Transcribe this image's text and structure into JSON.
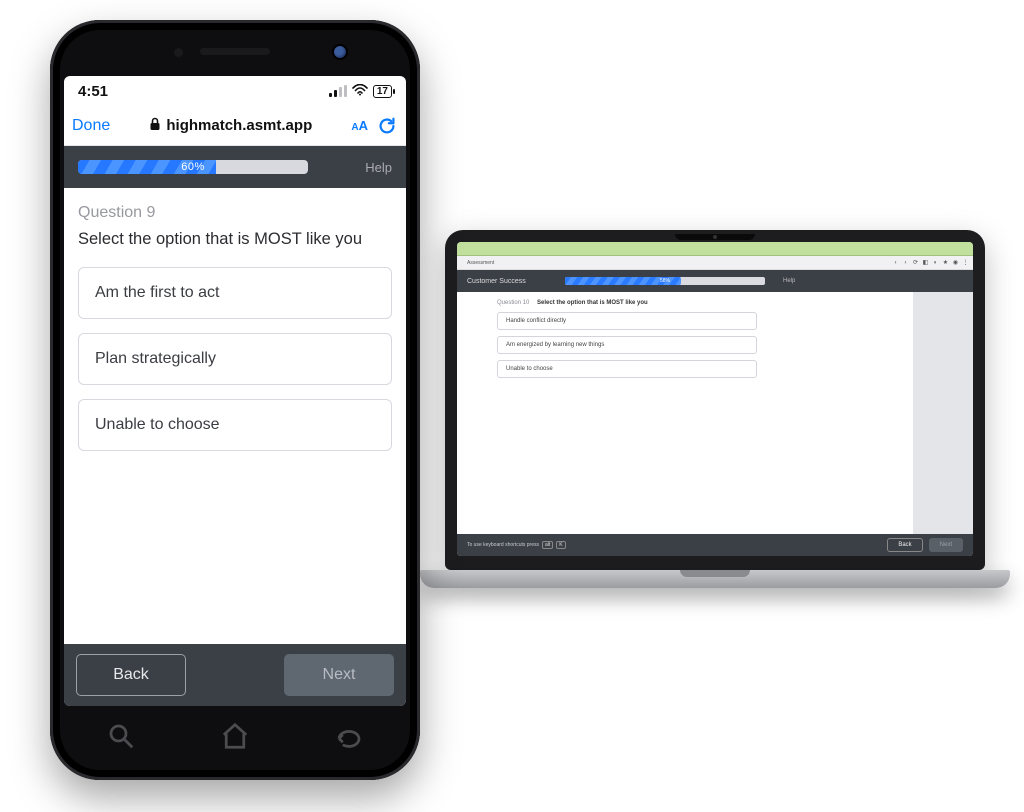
{
  "phone": {
    "status": {
      "time": "4:51",
      "battery": "17"
    },
    "safari": {
      "done": "Done",
      "url": "highmatch.asmt.app",
      "aa": "AA"
    },
    "progress": {
      "percent": 60,
      "label": "60%"
    },
    "help": "Help",
    "question_label": "Question 9",
    "prompt": "Select the option that is MOST like you",
    "options": [
      "Am the first to act",
      "Plan strategically",
      "Unable to choose"
    ],
    "back": "Back",
    "next": "Next"
  },
  "laptop": {
    "tab_label": "Assessment",
    "header_title": "Customer Success",
    "progress": {
      "percent": 58,
      "label": "58%"
    },
    "help": "Help",
    "question_label": "Question 10",
    "prompt": "Select the option that is MOST like you",
    "options": [
      "Handle conflict directly",
      "Am energized by learning new things",
      "Unable to choose"
    ],
    "kbd_hint_text": "To use keyboard shortcuts press",
    "kbd_key_1": "alt",
    "kbd_key_2": "K",
    "back": "Back",
    "next": "Next"
  }
}
